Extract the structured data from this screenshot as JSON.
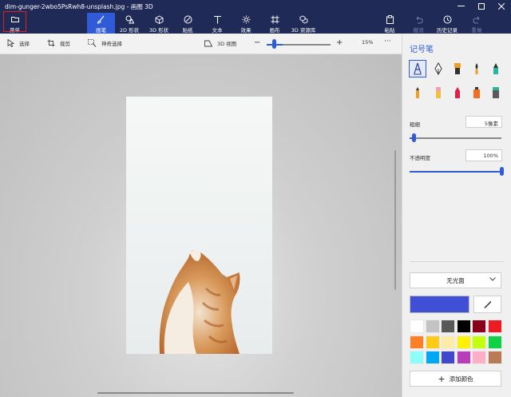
{
  "window": {
    "title": "dim-gunger-2wbo5PsRwh8-unsplash.jpg - 画图 3D",
    "controls": [
      "minimize-icon",
      "maximize-icon",
      "close-icon"
    ]
  },
  "ribbon": {
    "menu_label": "菜单",
    "tools": [
      {
        "label": "画笔",
        "icon": "brush-icon",
        "active": true
      },
      {
        "label": "2D 形状",
        "icon": "2d-shapes-icon"
      },
      {
        "label": "3D 形状",
        "icon": "3d-shapes-icon"
      },
      {
        "label": "贴纸",
        "icon": "sticker-icon"
      },
      {
        "label": "文本",
        "icon": "text-icon"
      },
      {
        "label": "效果",
        "icon": "effects-icon"
      },
      {
        "label": "画布",
        "icon": "canvas-icon"
      },
      {
        "label": "3D 资源库",
        "icon": "3d-library-icon"
      }
    ],
    "paste_label": "粘贴",
    "undo_label": "撤消",
    "history_label": "历史记录",
    "redo_label": "重做"
  },
  "toolbar": {
    "select_label": "选择",
    "crop_label": "裁剪",
    "magic_select_label": "神奇选择",
    "view3d_label": "3D 视图",
    "zoom_value": "15%",
    "zoom_level": 0.12,
    "more": "···"
  },
  "panel": {
    "title": "记号笔",
    "brushes": [
      "marker-icon",
      "calligraphy-pen-icon",
      "oil-brush-icon",
      "watercolor-icon",
      "pixel-pen-icon",
      "spray-can-icon",
      "pencil-icon",
      "eraser-icon",
      "crayon-icon",
      "pixel-pen-orange-icon",
      "fill-bucket-icon"
    ],
    "thickness_label": "粗细",
    "thickness_value": "5像素",
    "thickness_level": 0.05,
    "opacity_label": "不透明度",
    "opacity_value": "100%",
    "opacity_level": 1.0,
    "finish_value": "无光面",
    "current_color": "#3f4fd6",
    "palette": [
      "#ffffff",
      "#c3c3c3",
      "#585858",
      "#000000",
      "#88001b",
      "#ec1c24",
      "#ff7f27",
      "#ffca18",
      "#fdeca6",
      "#fff200",
      "#c4ff0e",
      "#0ed145",
      "#8cfffb",
      "#00a8f3",
      "#3f48cc",
      "#b83dba",
      "#ffaec8",
      "#b97a56"
    ],
    "add_color_label": "添加颜色"
  }
}
